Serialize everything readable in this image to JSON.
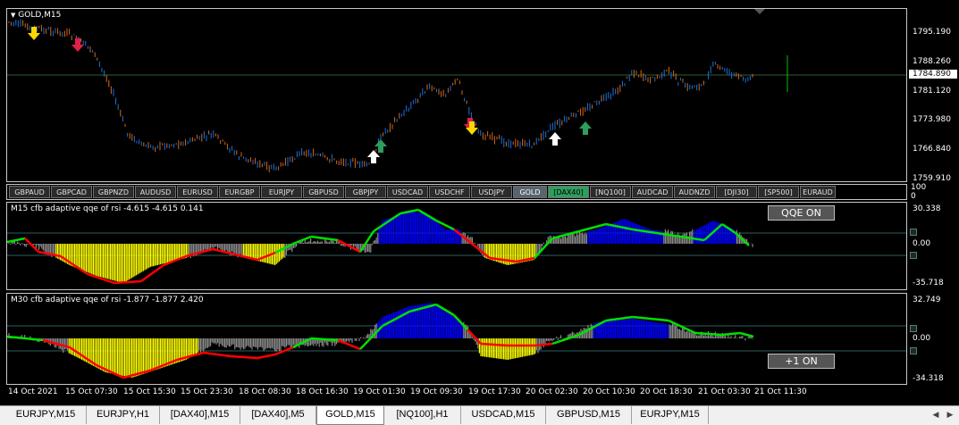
{
  "main_pane": {
    "title": "GOLD,M15",
    "price_ticks": [
      "1795.190",
      "1788.260",
      "1781.120",
      "1773.980",
      "1766.840",
      "1759.910"
    ],
    "current_price": "1784.890"
  },
  "symbol_buttons": [
    "GBPAUD",
    "GBPCAD",
    "GBPNZD",
    "AUDUSD",
    "EURUSD",
    "EURGBP",
    "EURJPY",
    "GBPUSD",
    "GBPJPY",
    "USDCAD",
    "USDCHF",
    "USDJPY",
    "GOLD",
    "[DAX40]",
    "[NQ100]",
    "AUDCAD",
    "AUDNZD",
    "[DJI30]",
    "[SP500]",
    "EURAUD"
  ],
  "symbol_axis_labels": [
    "100",
    "0"
  ],
  "indicator1": {
    "label": "M15  cfb adaptive qqe of rsi -4.615 -4.615 0.141",
    "button": "QQE  ON",
    "ticks": [
      "30.338",
      "0.00",
      "-35.718"
    ]
  },
  "indicator2": {
    "label": "M30  cfb adaptive qqe of rsi -1.877 -1.877 2.420",
    "button": "+1  ON",
    "ticks": [
      "32.749",
      "0.00",
      "-34.318"
    ]
  },
  "time_axis": [
    "14 Oct 2021",
    "15 Oct 07:30",
    "15 Oct 15:30",
    "15 Oct 23:30",
    "18 Oct 08:30",
    "18 Oct 16:30",
    "19 Oct 01:30",
    "19 Oct 09:30",
    "19 Oct 17:30",
    "20 Oct 02:30",
    "20 Oct 10:30",
    "20 Oct 18:30",
    "21 Oct 03:30",
    "21 Oct 11:30"
  ],
  "tabs": [
    "EURJPY,M15",
    "EURJPY,H1",
    "[DAX40],M15",
    "[DAX40],M5",
    "GOLD,M15",
    "[NQ100],H1",
    "USDCAD,M15",
    "GBPUSD,M15",
    "EURJPY,M15"
  ],
  "active_tab": "GOLD,M15",
  "colors": {
    "bull_candle": "#1e6fd9",
    "bear_candle": "#d2691e",
    "qqe_up": "#0000ff",
    "qqe_down": "#ffff00",
    "trend_up": "#00e000",
    "trend_down": "#ff0000"
  }
}
